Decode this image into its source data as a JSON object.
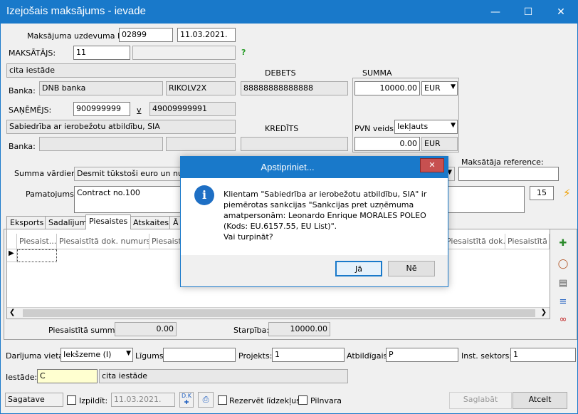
{
  "window": {
    "title": "Izejošais maksājums - ievade"
  },
  "payer_section": {
    "order_no_label": "Maksājuma uzdevuma Nr.",
    "order_no": "02899",
    "order_date": "11.03.2021.",
    "payer_label": "MAKSĀTĀJS:",
    "payer_code": "11",
    "payer_name": "cita iestāde",
    "bank_label": "Banka:",
    "bank_name": "DNB banka",
    "bank_code": "RIKOLV2X"
  },
  "debet": {
    "label": "DEBETS",
    "account": "88888888888888"
  },
  "summa": {
    "label": "SUMMA",
    "amount": "10000.00",
    "currency": "EUR",
    "pvn_label": "PVN veids:",
    "pvn_value": "Iekļauts",
    "pvn_amount": "0.00",
    "pvn_currency": "EUR"
  },
  "receiver_section": {
    "receiver_label": "SAŅĒMĒJS:",
    "receiver_code": "900999999",
    "v_label": "v",
    "receiver_reg": "49009999991",
    "receiver_name": "Sabiedrība ar ierobežotu atbildību, SIA",
    "bank_label": "Banka:"
  },
  "kredits": {
    "label": "KREDĪTS"
  },
  "words": {
    "label": "Summa vārdiem:",
    "value": "Desmit tūkstoši euro un nulle c"
  },
  "reference": {
    "label": "Maksātāja reference:"
  },
  "pamatojums": {
    "label": "Pamatojums:",
    "value": "Contract no.100",
    "count": "15"
  },
  "tabs": [
    {
      "label": "Eksports"
    },
    {
      "label": "Sadalījums"
    },
    {
      "label": "Piesaistes"
    },
    {
      "label": "Atskaites"
    },
    {
      "label": "Ā"
    }
  ],
  "grid": {
    "columns": [
      "Piesaist...",
      "Piesaistītā dok. numurs",
      "Piesaist",
      "Piesaistītā dok. v...",
      "Piesaistītā d"
    ]
  },
  "totals": {
    "linked_label": "Piesaistītā summa:",
    "linked_value": "0.00",
    "diff_label": "Starpība:",
    "diff_value": "10000.00"
  },
  "bottom": {
    "place_label": "Darījuma vieta:",
    "place_value": "Iekšzeme (I)",
    "contract_label": "Līgums:",
    "project_label": "Projekts:",
    "project_value": "1",
    "resp_label": "Atbildīgais:",
    "resp_value": "P",
    "sector_label": "Inst. sektors:",
    "sector_value": "1",
    "institution_label": "Iestāde:",
    "institution_code": "C",
    "institution_name": "cita iestāde"
  },
  "statusbar": {
    "status": "Sagatave",
    "execute_label": "Izpildīt:",
    "execute_date": "11.03.2021.",
    "reserve_label": "Rezervēt līdzekļus",
    "full_label": "Pilnvara",
    "save_label": "Saglabāt",
    "cancel_label": "Atcelt"
  },
  "dialog": {
    "title": "Apstipriniet...",
    "message": "Klientam \"Sabiedrība ar ierobežotu atbildību, SIA\" ir piemērotas sankcijas \"Sankcijas pret uzņēmuma amatpersonām: Leonardo Enrique MORALES POLEO (Kods: EU.6157.55, EU List)\".",
    "question": "Vai turpināt?",
    "yes": "Jā",
    "no": "Nē"
  },
  "colors": {
    "titlebar": "#1979ca",
    "dialog_close": "#c75050"
  }
}
